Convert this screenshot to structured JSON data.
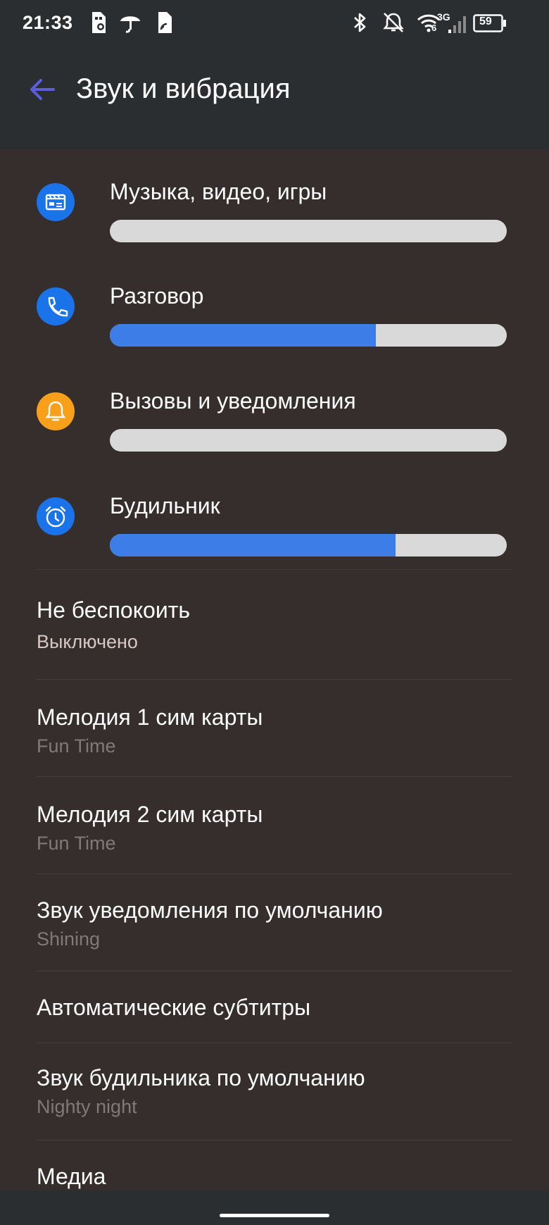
{
  "status_bar": {
    "time": "21:33",
    "network_label": "3G",
    "signal_sub": "6",
    "battery": "59",
    "icons": [
      "sim-settings-icon",
      "umbrella-icon",
      "sim-card-icon",
      "bluetooth-icon",
      "bell-off-icon",
      "wifi-icon",
      "signal-icon",
      "battery-icon"
    ]
  },
  "header": {
    "title": "Звук и вибрация",
    "back_icon": "back-arrow-icon"
  },
  "volume": [
    {
      "label": "Музыка, видео, игры",
      "level": 0.0,
      "icon": "media-icon",
      "color": "#1a73e8"
    },
    {
      "label": "Разговор",
      "level": 0.67,
      "icon": "phone-icon",
      "color": "#1a73e8"
    },
    {
      "label": "Вызовы и уведомления",
      "level": 0.0,
      "icon": "bell-icon",
      "color": "#f9a01b"
    },
    {
      "label": "Будильник",
      "level": 0.72,
      "icon": "alarm-icon",
      "color": "#1a73e8"
    }
  ],
  "settings": [
    {
      "title": "Не беспокоить",
      "subtitle": "Выключено"
    },
    {
      "title": "Мелодия 1 сим карты",
      "subtitle": "Fun Time"
    },
    {
      "title": "Мелодия 2 сим карты",
      "subtitle": "Fun Time"
    },
    {
      "title": "Звук уведомления по умолчанию",
      "subtitle": "Shining"
    },
    {
      "title": "Автоматические субтитры",
      "subtitle": ""
    },
    {
      "title": "Звук будильника по умолчанию",
      "subtitle": "Nighty night"
    },
    {
      "title": "Медиа",
      "subtitle": ""
    }
  ],
  "colors": {
    "accent": "#3c7de8",
    "back_arrow": "#5b5ce0",
    "track": "#d9d9d9",
    "subtitle_primary": "#d9c7c3",
    "subtitle_muted": "#7e7a79"
  }
}
